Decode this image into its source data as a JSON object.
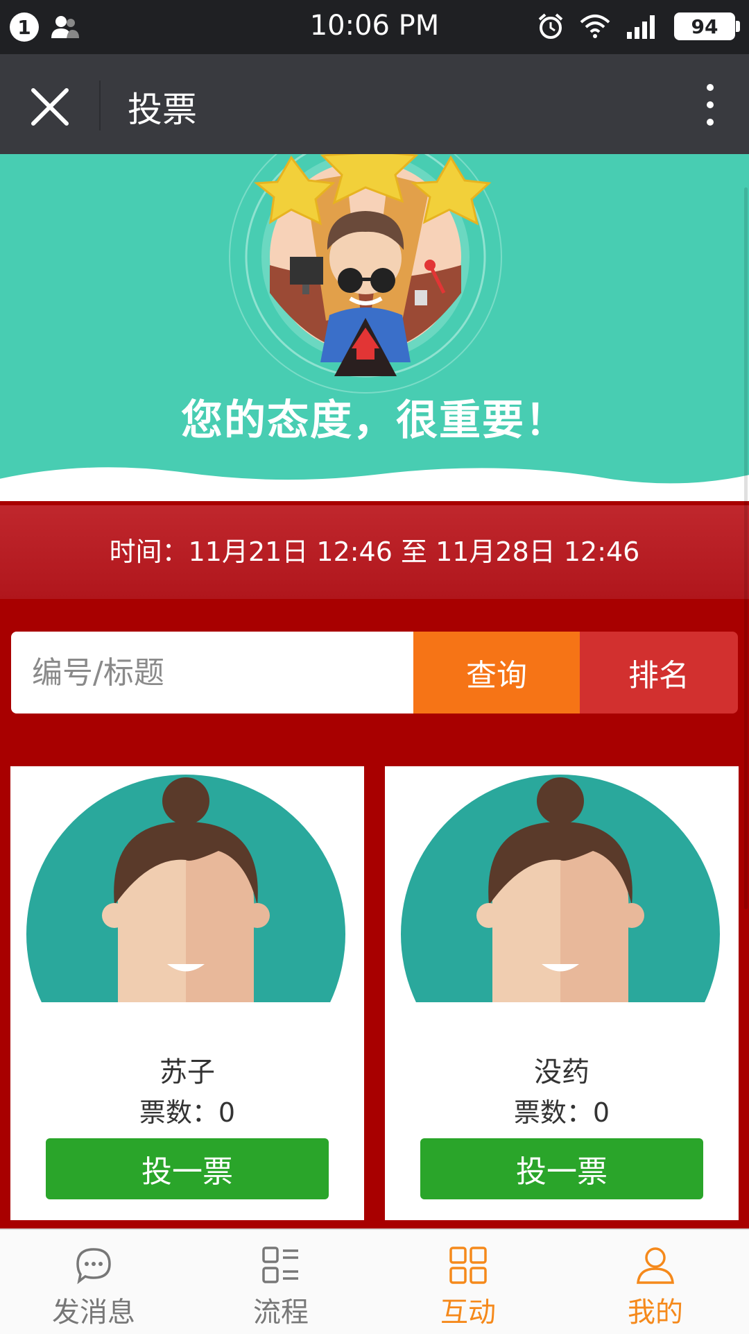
{
  "status": {
    "notif_count": "1",
    "time": "10:06 PM",
    "battery": "94"
  },
  "nav": {
    "title": "投票"
  },
  "banner": {
    "title": "您的态度，很重要！"
  },
  "vote_period": "时间：11月21日 12:46 至 11月28日 12:46",
  "search": {
    "placeholder": "编号/标题",
    "query_label": "查询",
    "rank_label": "排名"
  },
  "candidates": [
    {
      "name": "苏子",
      "votes_text": "票数：0",
      "vote_label": "投一票"
    },
    {
      "name": "没药",
      "votes_text": "票数：0",
      "vote_label": "投一票"
    }
  ],
  "tabs": [
    {
      "label": "发消息",
      "icon": "chat-icon"
    },
    {
      "label": "流程",
      "icon": "list-icon"
    },
    {
      "label": "互动",
      "icon": "grid-icon"
    },
    {
      "label": "我的",
      "icon": "user-icon"
    }
  ],
  "colors": {
    "banner": "#48cdb2",
    "query": "#f67416",
    "rank": "#d2302f",
    "vote": "#2aa52a",
    "active_tab": "#f5891b"
  }
}
